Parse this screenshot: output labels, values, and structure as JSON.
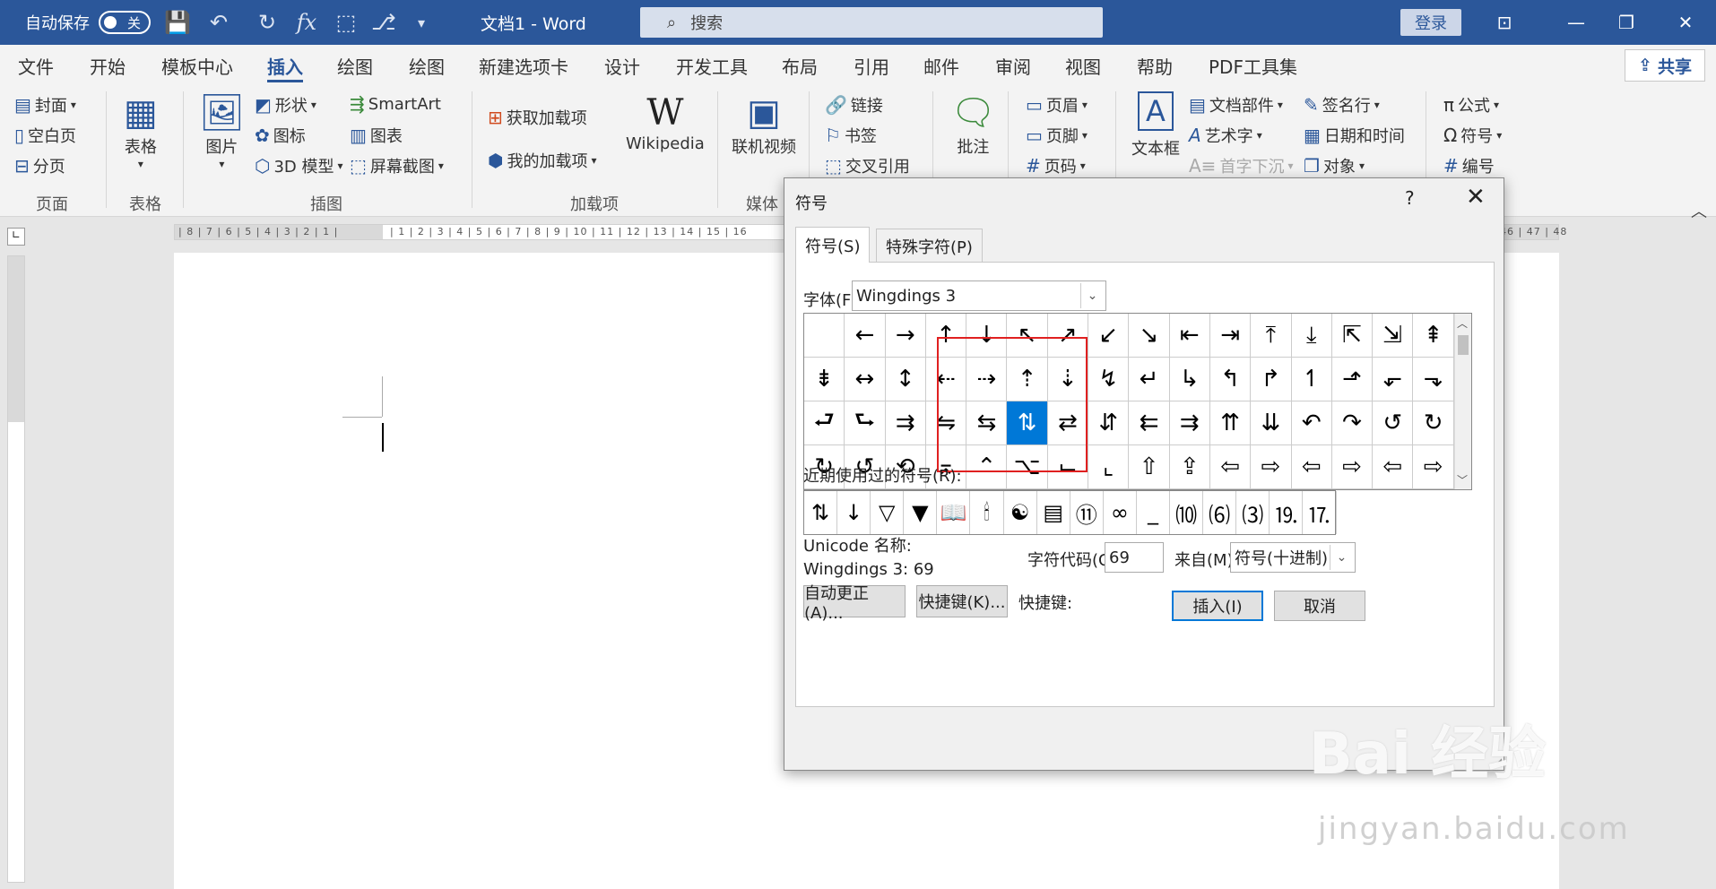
{
  "titlebar": {
    "autosave_label": "自动保存",
    "autosave_state": "关",
    "doc_title": "文档1 - Word",
    "search_placeholder": "搜索",
    "login": "登录"
  },
  "tabs": [
    "文件",
    "开始",
    "模板中心",
    "插入",
    "绘图",
    "绘图",
    "新建选项卡",
    "设计",
    "开发工具",
    "布局",
    "引用",
    "邮件",
    "审阅",
    "视图",
    "帮助",
    "PDF工具集"
  ],
  "active_tab": "插入",
  "share_label": "共享",
  "ribbon": {
    "pages": {
      "cover": "封面",
      "blank": "空白页",
      "break": "分页",
      "label": "页面"
    },
    "tables": {
      "table": "表格",
      "label": "表格"
    },
    "illustrations": {
      "picture": "图片",
      "shapes": "形状",
      "icons": "图标",
      "model3d": "3D 模型",
      "smartart": "SmartArt",
      "chart": "图表",
      "screenshot": "屏幕截图",
      "label": "插图"
    },
    "addins": {
      "get": "获取加载项",
      "my": "我的加载项",
      "wiki": "Wikipedia",
      "label": "加载项"
    },
    "media": {
      "video": "联机视频",
      "label": "媒体"
    },
    "links": {
      "link": "链接",
      "bookmark": "书签",
      "crossref": "交叉引用"
    },
    "comments": {
      "comment": "批注"
    },
    "headerfooter": {
      "header": "页眉",
      "footer": "页脚",
      "pagenum": "页码"
    },
    "text": {
      "textbox": "文本框",
      "parts": "文档部件",
      "wordart": "艺术字",
      "dropcap": "首字下沉",
      "sigline": "签名行",
      "datetime": "日期和时间",
      "object": "对象"
    },
    "symbols": {
      "equation": "公式",
      "symbol": "符号",
      "number": "编号"
    }
  },
  "ruler": {
    "left_numbers": "| 8 | 7 | 6 | 5 | 4 | 3 | 2 | 1 |",
    "right_numbers": "| 1 | 2 | 3 | 4 | 5 | 6 | 7 | 8 | 9 | 10 | 11 | 12 | 13 | 14 | 15 | 16",
    "far_right": "46 | 47 | 48"
  },
  "dialog": {
    "title": "符号",
    "help": "?",
    "tab_symbols": "符号(S)",
    "tab_special": "特殊字符(P)",
    "font_label": "字体(F):",
    "font_value": "Wingdings 3",
    "grid_rows": [
      [
        " ",
        "←",
        "→",
        "↑",
        "↓",
        "↖",
        "↗",
        "↙",
        "↘",
        "⇤",
        "⇥",
        "⤒",
        "⤓",
        "⇱",
        "⇲",
        "⇞"
      ],
      [
        "⇟",
        "↔",
        "↕",
        "⇠",
        "⇢",
        "⇡",
        "⇣",
        "↯",
        "↵",
        "↳",
        "↰",
        "↱",
        "↿",
        "⬏",
        "⬐",
        "⬎"
      ],
      [
        "⮐",
        "⮑",
        "⇉",
        "⇋",
        "⇆",
        "⇅",
        "⇄",
        "⇵",
        "⇇",
        "⇉",
        "⇈",
        "⇊",
        "↶",
        "↷",
        "↺",
        "↻"
      ],
      [
        "↻",
        "↺",
        "⟲",
        "⌅",
        "⌃",
        "⌥",
        "⌙",
        "⌞",
        "⇧",
        "⇪",
        "⇦",
        "⇨",
        "⇦",
        "⇨",
        "⇦",
        "⇨"
      ]
    ],
    "selected": "⇅",
    "recent_label": "近期使用过的符号(R):",
    "recent": [
      "⇅",
      "↓",
      "▽",
      "▼",
      "📖",
      "🕯",
      "☯",
      "▤",
      "⑪",
      "∞",
      "_",
      "⑽",
      "⑹",
      "⑶",
      "⒚",
      "⒘"
    ],
    "unicode_label": "Unicode 名称:",
    "unicode_name": "Wingdings 3: 69",
    "code_label": "字符代码(C):",
    "code_value": "69",
    "from_label": "来自(M):",
    "from_value": "符号(十进制)",
    "autocorrect": "自动更正(A)...",
    "shortcut_btn": "快捷键(K)...",
    "shortcut_label": "快捷键:",
    "insert": "插入(I)",
    "cancel": "取消"
  },
  "watermark": {
    "logo": "Bai 经验",
    "url": "jingyan.baidu.com"
  }
}
